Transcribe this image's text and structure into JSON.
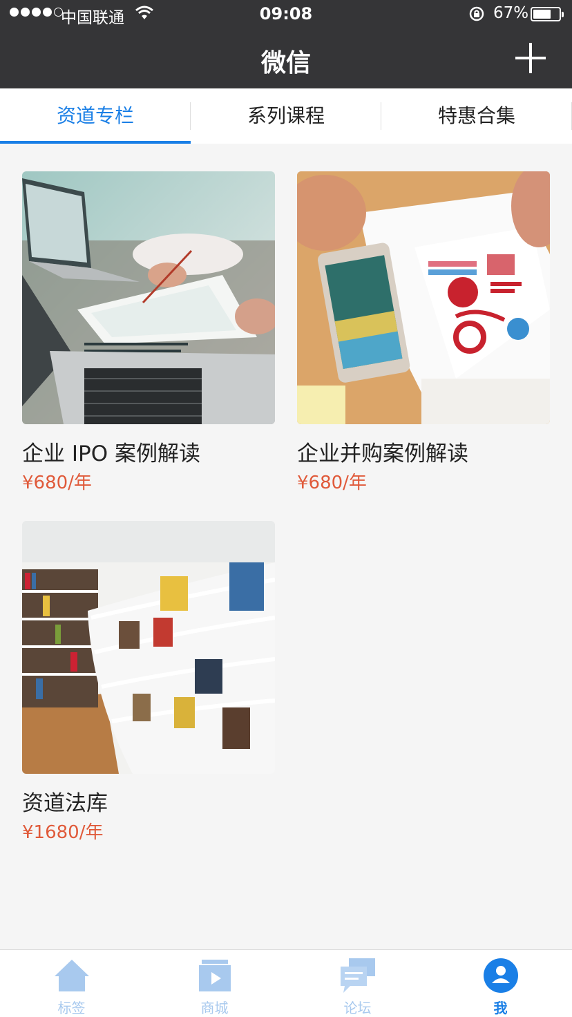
{
  "status_bar": {
    "carrier": "中国联通",
    "time": "09:08",
    "battery": "67%",
    "battery_level": 0.67,
    "signal_bars_filled": 4,
    "signal_bars_total": 5
  },
  "nav": {
    "title": "微信",
    "add_icon": "plus-icon"
  },
  "tabs": [
    {
      "label": "资道专栏",
      "active": true
    },
    {
      "label": "系列课程",
      "active": false
    },
    {
      "label": "特惠合集",
      "active": false
    }
  ],
  "products": [
    {
      "name": "企业 IPO 案例解读",
      "price": "¥680/年",
      "image": "laptops-on-desk-photo"
    },
    {
      "name": "企业并购案例解读",
      "price": "¥680/年",
      "image": "tablet-with-charts-photo"
    },
    {
      "name": "资道法库",
      "price": "¥1680/年",
      "image": "library-bookshelves-photo"
    }
  ],
  "tabbar": [
    {
      "label": "标签",
      "icon": "home-icon",
      "active": false
    },
    {
      "label": "商城",
      "icon": "shop-video-icon",
      "active": false
    },
    {
      "label": "论坛",
      "icon": "forum-chat-icon",
      "active": false
    },
    {
      "label": "我",
      "icon": "user-profile-icon",
      "active": true
    }
  ],
  "colors": {
    "accent": "#1a7fe6",
    "price": "#e05a3a",
    "navbar": "#353537"
  }
}
